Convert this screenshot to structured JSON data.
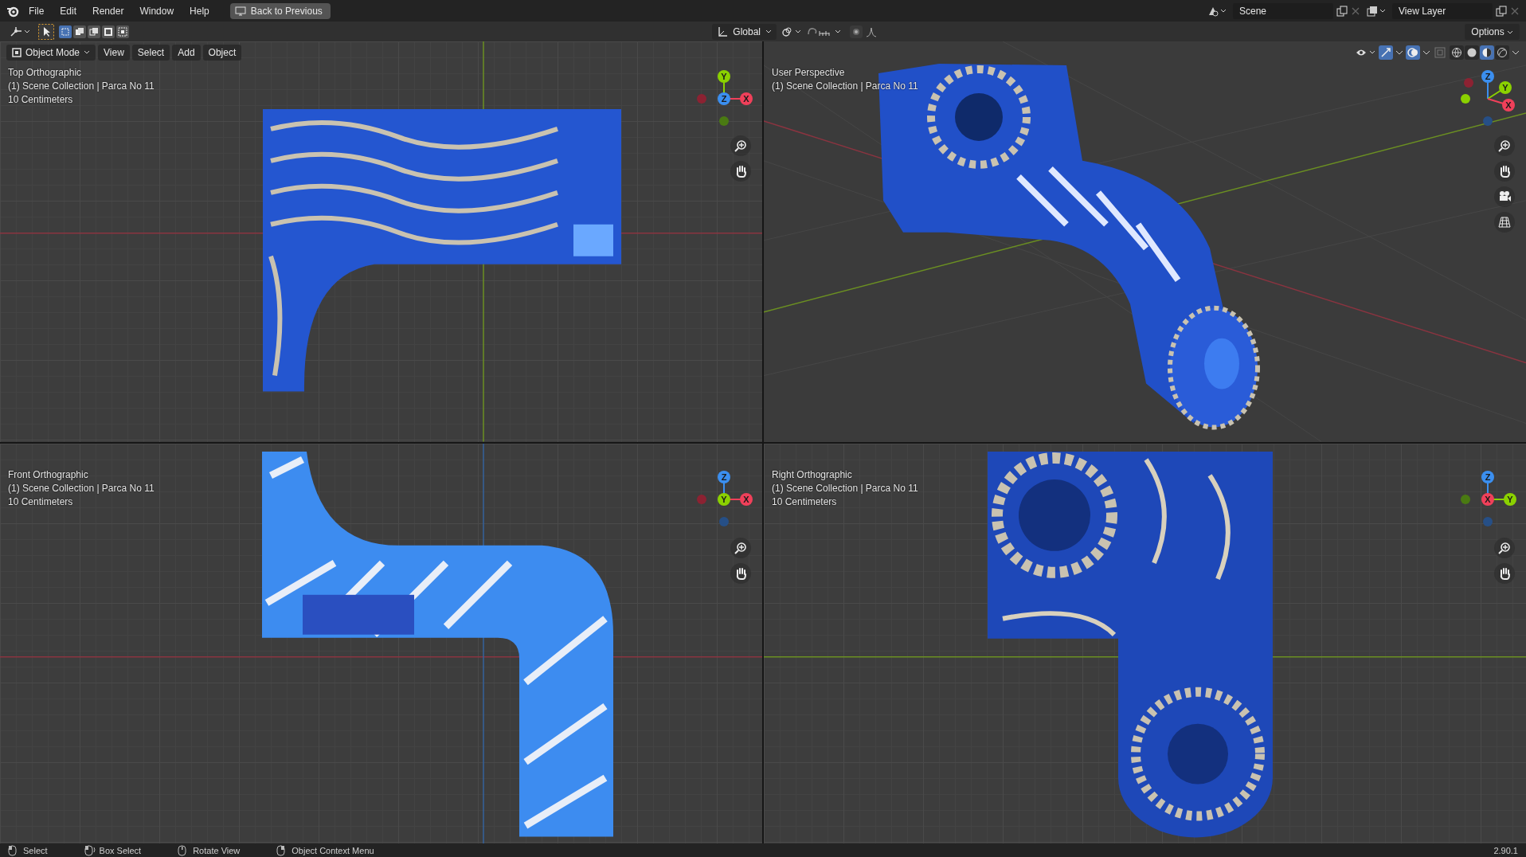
{
  "topbar": {
    "menus": [
      "File",
      "Edit",
      "Render",
      "Window",
      "Help"
    ],
    "back_button": "Back to Previous",
    "scene": "Scene",
    "view_layer": "View Layer"
  },
  "tool_header": {
    "selection_modes": [
      {
        "selected": true
      },
      {
        "selected": false
      },
      {
        "selected": false
      },
      {
        "selected": false
      },
      {
        "selected": false
      }
    ],
    "transform_orientation": "Global",
    "options": "Options"
  },
  "viewport_header": {
    "mode": "Object Mode",
    "menus": [
      "View",
      "Select",
      "Add",
      "Object"
    ],
    "shading_modes": [
      {
        "selected": false
      },
      {
        "selected": false
      },
      {
        "selected": true
      },
      {
        "selected": false
      }
    ]
  },
  "viewports": [
    {
      "kind": "top",
      "title": "Top Orthographic",
      "collection": "(1) Scene Collection | Parca No 11",
      "scale": "10 Centimeters",
      "gizmo": [
        {
          "color": "#8c2232"
        },
        {
          "color": "#4a7a12"
        },
        {
          "label": "Y",
          "color": "#8bd100"
        },
        {
          "label": "X",
          "color": "#f0405a"
        },
        {
          "label": "Z",
          "color": "#3b8ff0"
        }
      ]
    },
    {
      "kind": "perspective",
      "title": "User Perspective",
      "collection": "(1) Scene Collection | Parca No 11",
      "gizmo": [
        {
          "color": "#264f86"
        },
        {
          "color": "#8c2232"
        },
        {
          "color": "#8bd100"
        },
        {
          "label": "Z",
          "color": "#3b8ff0"
        },
        {
          "label": "Y",
          "color": "#8bd100"
        },
        {
          "label": "X",
          "color": "#f0405a"
        }
      ]
    },
    {
      "kind": "front",
      "title": "Front Orthographic",
      "collection": "(1) Scene Collection | Parca No 11",
      "scale": "10 Centimeters",
      "gizmo": [
        {
          "color": "#8c2232"
        },
        {
          "color": "#264f86"
        },
        {
          "label": "Z",
          "color": "#3b8ff0"
        },
        {
          "label": "X",
          "color": "#f0405a"
        },
        {
          "label": "Y",
          "color": "#8bd100"
        }
      ]
    },
    {
      "kind": "right",
      "title": "Right Orthographic",
      "collection": "(1) Scene Collection | Parca No 11",
      "scale": "10 Centimeters",
      "gizmo": [
        {
          "color": "#4a7a12"
        },
        {
          "color": "#264f86"
        },
        {
          "label": "Z",
          "color": "#3b8ff0"
        },
        {
          "label": "Y",
          "color": "#8bd100"
        },
        {
          "label": "X",
          "color": "#f0405a"
        }
      ]
    }
  ],
  "status_bar": {
    "hints": [
      {
        "label": "Select",
        "kind": "left"
      },
      {
        "label": "Box Select",
        "kind": "drag"
      },
      {
        "label": "Rotate View",
        "kind": "middle"
      },
      {
        "label": "Object Context Menu",
        "kind": "right"
      }
    ],
    "version": "2.90.1"
  }
}
